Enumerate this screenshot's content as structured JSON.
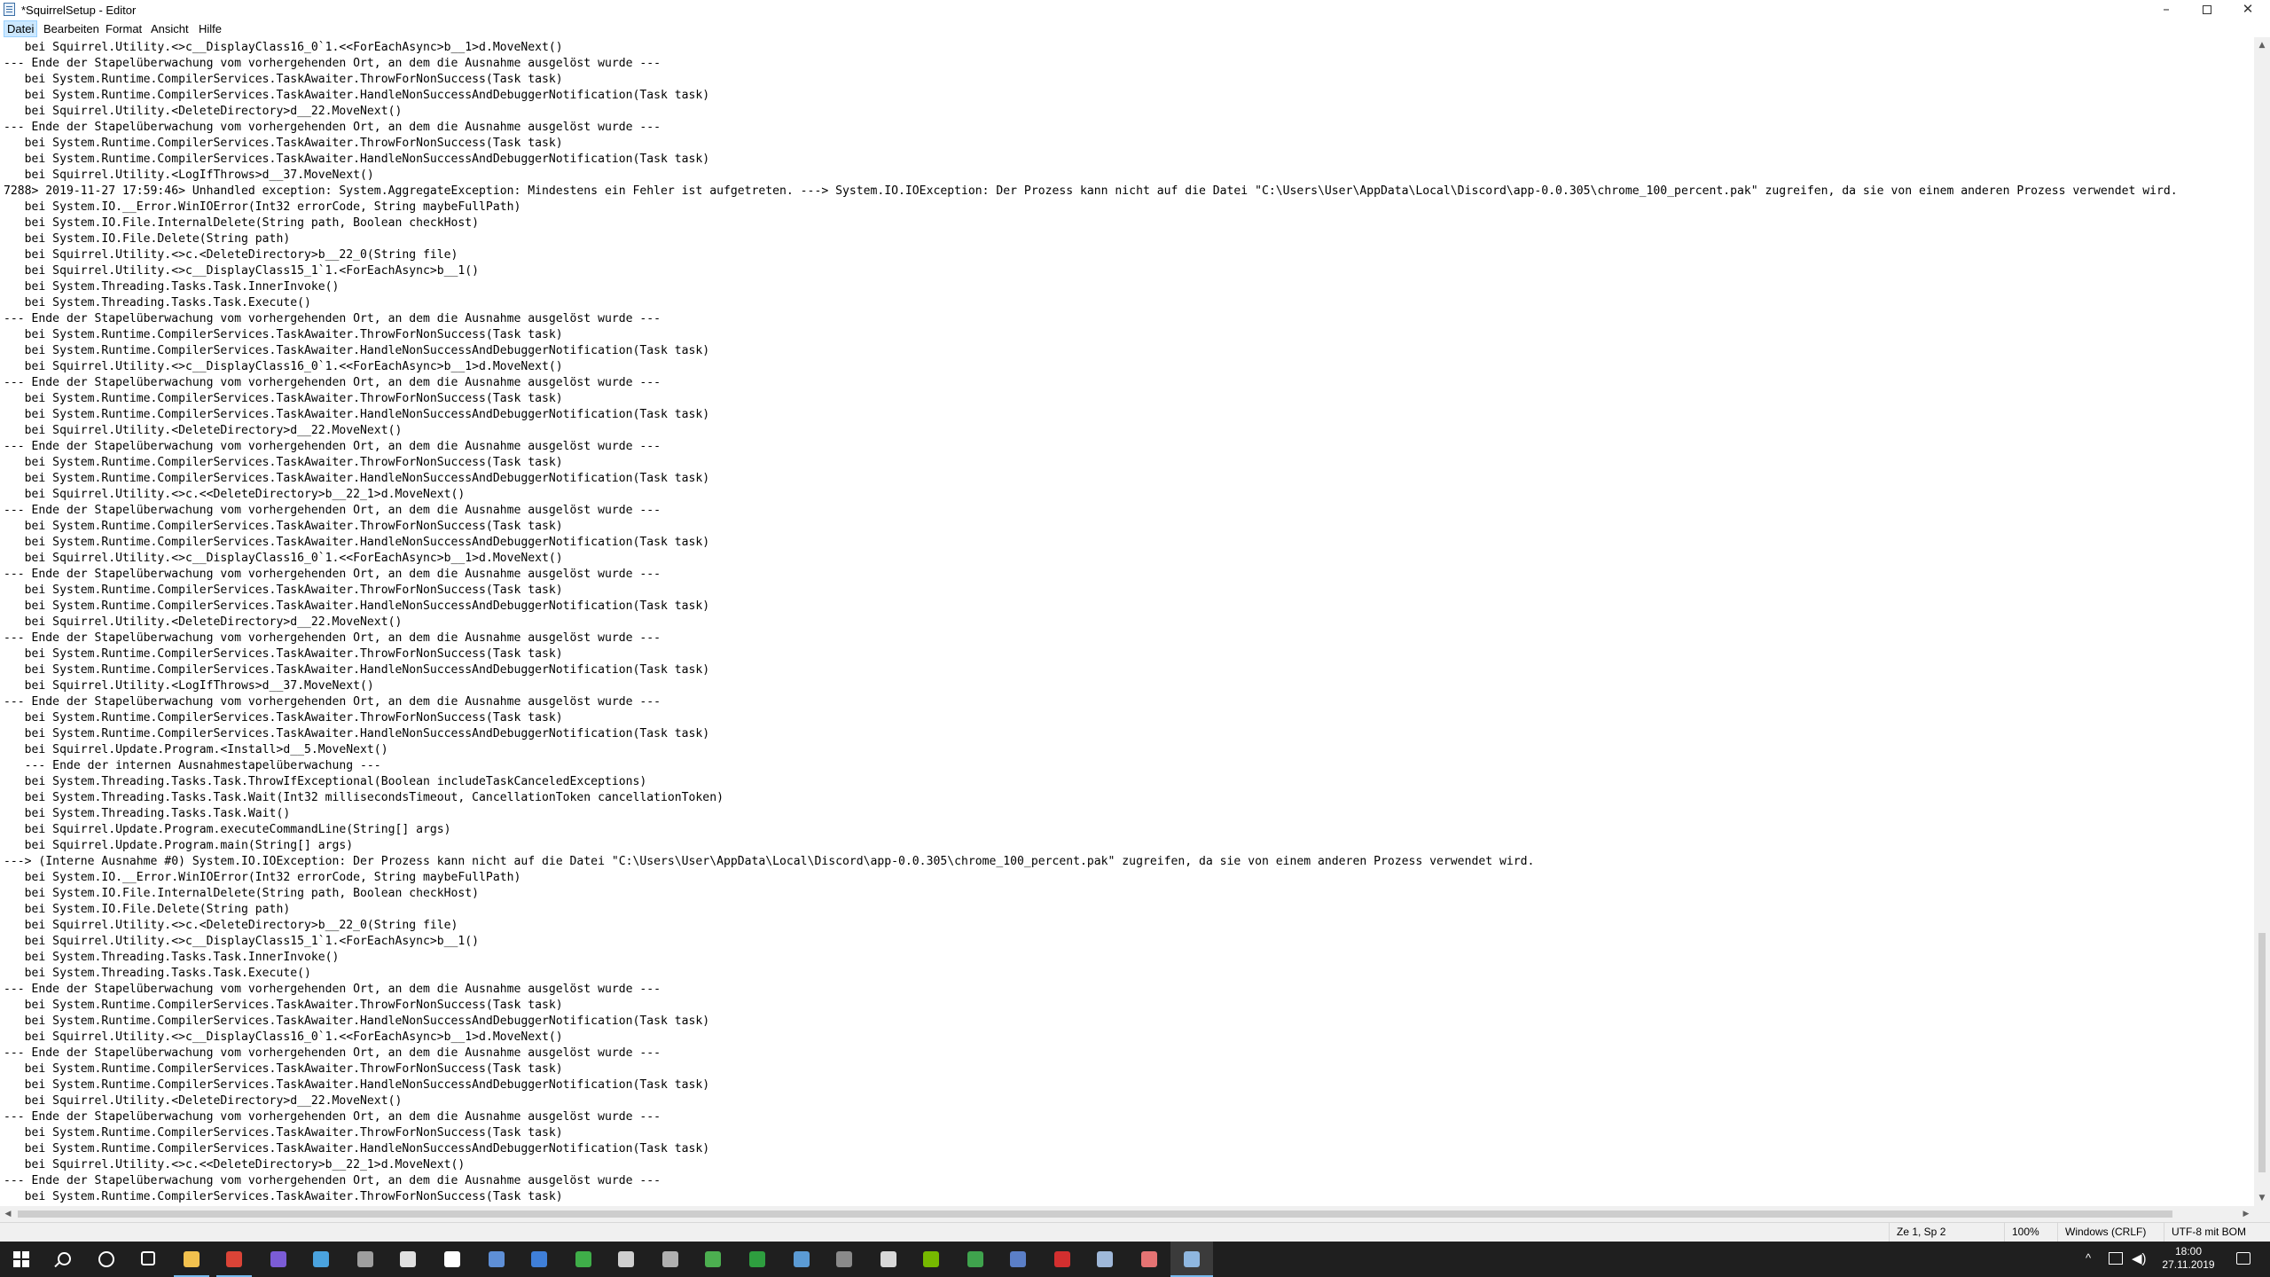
{
  "window": {
    "title": "*SquirrelSetup - Editor",
    "minimize": "–",
    "close": "✕"
  },
  "menu": {
    "datei": "Datei",
    "bearbeiten": "Bearbeiten",
    "format": "Format",
    "ansicht": "Ansicht",
    "hilfe": "Hilfe"
  },
  "editor": {
    "lines": [
      "   bei Squirrel.Utility.<>c__DisplayClass16_0`1.<<ForEachAsync>b__1>d.MoveNext()",
      "--- Ende der Stapelüberwachung vom vorhergehenden Ort, an dem die Ausnahme ausgelöst wurde ---",
      "   bei System.Runtime.CompilerServices.TaskAwaiter.ThrowForNonSuccess(Task task)",
      "   bei System.Runtime.CompilerServices.TaskAwaiter.HandleNonSuccessAndDebuggerNotification(Task task)",
      "   bei Squirrel.Utility.<DeleteDirectory>d__22.MoveNext()",
      "--- Ende der Stapelüberwachung vom vorhergehenden Ort, an dem die Ausnahme ausgelöst wurde ---",
      "   bei System.Runtime.CompilerServices.TaskAwaiter.ThrowForNonSuccess(Task task)",
      "   bei System.Runtime.CompilerServices.TaskAwaiter.HandleNonSuccessAndDebuggerNotification(Task task)",
      "   bei Squirrel.Utility.<LogIfThrows>d__37.MoveNext()",
      "7288> 2019-11-27 17:59:46> Unhandled exception: System.AggregateException: Mindestens ein Fehler ist aufgetreten. ---> System.IO.IOException: Der Prozess kann nicht auf die Datei \"C:\\Users\\User\\AppData\\Local\\Discord\\app-0.0.305\\chrome_100_percent.pak\" zugreifen, da sie von einem anderen Prozess verwendet wird.",
      "   bei System.IO.__Error.WinIOError(Int32 errorCode, String maybeFullPath)",
      "   bei System.IO.File.InternalDelete(String path, Boolean checkHost)",
      "   bei System.IO.File.Delete(String path)",
      "   bei Squirrel.Utility.<>c.<DeleteDirectory>b__22_0(String file)",
      "   bei Squirrel.Utility.<>c__DisplayClass15_1`1.<ForEachAsync>b__1()",
      "   bei System.Threading.Tasks.Task.InnerInvoke()",
      "   bei System.Threading.Tasks.Task.Execute()",
      "--- Ende der Stapelüberwachung vom vorhergehenden Ort, an dem die Ausnahme ausgelöst wurde ---",
      "   bei System.Runtime.CompilerServices.TaskAwaiter.ThrowForNonSuccess(Task task)",
      "   bei System.Runtime.CompilerServices.TaskAwaiter.HandleNonSuccessAndDebuggerNotification(Task task)",
      "   bei Squirrel.Utility.<>c__DisplayClass16_0`1.<<ForEachAsync>b__1>d.MoveNext()",
      "--- Ende der Stapelüberwachung vom vorhergehenden Ort, an dem die Ausnahme ausgelöst wurde ---",
      "   bei System.Runtime.CompilerServices.TaskAwaiter.ThrowForNonSuccess(Task task)",
      "   bei System.Runtime.CompilerServices.TaskAwaiter.HandleNonSuccessAndDebuggerNotification(Task task)",
      "   bei Squirrel.Utility.<DeleteDirectory>d__22.MoveNext()",
      "--- Ende der Stapelüberwachung vom vorhergehenden Ort, an dem die Ausnahme ausgelöst wurde ---",
      "   bei System.Runtime.CompilerServices.TaskAwaiter.ThrowForNonSuccess(Task task)",
      "   bei System.Runtime.CompilerServices.TaskAwaiter.HandleNonSuccessAndDebuggerNotification(Task task)",
      "   bei Squirrel.Utility.<>c.<<DeleteDirectory>b__22_1>d.MoveNext()",
      "--- Ende der Stapelüberwachung vom vorhergehenden Ort, an dem die Ausnahme ausgelöst wurde ---",
      "   bei System.Runtime.CompilerServices.TaskAwaiter.ThrowForNonSuccess(Task task)",
      "   bei System.Runtime.CompilerServices.TaskAwaiter.HandleNonSuccessAndDebuggerNotification(Task task)",
      "   bei Squirrel.Utility.<>c__DisplayClass16_0`1.<<ForEachAsync>b__1>d.MoveNext()",
      "--- Ende der Stapelüberwachung vom vorhergehenden Ort, an dem die Ausnahme ausgelöst wurde ---",
      "   bei System.Runtime.CompilerServices.TaskAwaiter.ThrowForNonSuccess(Task task)",
      "   bei System.Runtime.CompilerServices.TaskAwaiter.HandleNonSuccessAndDebuggerNotification(Task task)",
      "   bei Squirrel.Utility.<DeleteDirectory>d__22.MoveNext()",
      "--- Ende der Stapelüberwachung vom vorhergehenden Ort, an dem die Ausnahme ausgelöst wurde ---",
      "   bei System.Runtime.CompilerServices.TaskAwaiter.ThrowForNonSuccess(Task task)",
      "   bei System.Runtime.CompilerServices.TaskAwaiter.HandleNonSuccessAndDebuggerNotification(Task task)",
      "   bei Squirrel.Utility.<LogIfThrows>d__37.MoveNext()",
      "--- Ende der Stapelüberwachung vom vorhergehenden Ort, an dem die Ausnahme ausgelöst wurde ---",
      "   bei System.Runtime.CompilerServices.TaskAwaiter.ThrowForNonSuccess(Task task)",
      "   bei System.Runtime.CompilerServices.TaskAwaiter.HandleNonSuccessAndDebuggerNotification(Task task)",
      "   bei Squirrel.Update.Program.<Install>d__5.MoveNext()",
      "   --- Ende der internen Ausnahmestapelüberwachung ---",
      "   bei System.Threading.Tasks.Task.ThrowIfExceptional(Boolean includeTaskCanceledExceptions)",
      "   bei System.Threading.Tasks.Task.Wait(Int32 millisecondsTimeout, CancellationToken cancellationToken)",
      "   bei System.Threading.Tasks.Task.Wait()",
      "   bei Squirrel.Update.Program.executeCommandLine(String[] args)",
      "   bei Squirrel.Update.Program.main(String[] args)",
      "---> (Interne Ausnahme #0) System.IO.IOException: Der Prozess kann nicht auf die Datei \"C:\\Users\\User\\AppData\\Local\\Discord\\app-0.0.305\\chrome_100_percent.pak\" zugreifen, da sie von einem anderen Prozess verwendet wird.",
      "   bei System.IO.__Error.WinIOError(Int32 errorCode, String maybeFullPath)",
      "   bei System.IO.File.InternalDelete(String path, Boolean checkHost)",
      "   bei System.IO.File.Delete(String path)",
      "   bei Squirrel.Utility.<>c.<DeleteDirectory>b__22_0(String file)",
      "   bei Squirrel.Utility.<>c__DisplayClass15_1`1.<ForEachAsync>b__1()",
      "   bei System.Threading.Tasks.Task.InnerInvoke()",
      "   bei System.Threading.Tasks.Task.Execute()",
      "--- Ende der Stapelüberwachung vom vorhergehenden Ort, an dem die Ausnahme ausgelöst wurde ---",
      "   bei System.Runtime.CompilerServices.TaskAwaiter.ThrowForNonSuccess(Task task)",
      "   bei System.Runtime.CompilerServices.TaskAwaiter.HandleNonSuccessAndDebuggerNotification(Task task)",
      "   bei Squirrel.Utility.<>c__DisplayClass16_0`1.<<ForEachAsync>b__1>d.MoveNext()",
      "--- Ende der Stapelüberwachung vom vorhergehenden Ort, an dem die Ausnahme ausgelöst wurde ---",
      "   bei System.Runtime.CompilerServices.TaskAwaiter.ThrowForNonSuccess(Task task)",
      "   bei System.Runtime.CompilerServices.TaskAwaiter.HandleNonSuccessAndDebuggerNotification(Task task)",
      "   bei Squirrel.Utility.<DeleteDirectory>d__22.MoveNext()",
      "--- Ende der Stapelüberwachung vom vorhergehenden Ort, an dem die Ausnahme ausgelöst wurde ---",
      "   bei System.Runtime.CompilerServices.TaskAwaiter.ThrowForNonSuccess(Task task)",
      "   bei System.Runtime.CompilerServices.TaskAwaiter.HandleNonSuccessAndDebuggerNotification(Task task)",
      "   bei Squirrel.Utility.<>c.<<DeleteDirectory>b__22_1>d.MoveNext()",
      "--- Ende der Stapelüberwachung vom vorhergehenden Ort, an dem die Ausnahme ausgelöst wurde ---",
      "   bei System.Runtime.CompilerServices.TaskAwaiter.ThrowForNonSuccess(Task task)"
    ]
  },
  "statusbar": {
    "position": "Ze 1, Sp 2",
    "zoom": "100%",
    "line_ending": "Windows (CRLF)",
    "encoding": "UTF-8 mit BOM"
  },
  "taskbar": {
    "icons": [
      {
        "name": "start-icon",
        "color": "#ffffff"
      },
      {
        "name": "search-icon",
        "color": "#ffffff"
      },
      {
        "name": "cortana-icon",
        "color": "#ffffff"
      },
      {
        "name": "task-view-icon",
        "color": "#ffffff"
      },
      {
        "name": "file-explorer-icon",
        "color": "#f2c14e"
      },
      {
        "name": "chrome-icon",
        "color": "#db4437"
      },
      {
        "name": "app-purple-icon",
        "color": "#7b5cd6"
      },
      {
        "name": "app-multicolor-icon",
        "color": "#4aa3df"
      },
      {
        "name": "app-terminal-icon",
        "color": "#9e9e9e"
      },
      {
        "name": "calculator-icon",
        "color": "#e0e0e0"
      },
      {
        "name": "snipping-icon",
        "color": "#ffffff"
      },
      {
        "name": "app-circle-icon",
        "color": "#5e8fd6"
      },
      {
        "name": "app-grid-icon",
        "color": "#3f7fd8"
      },
      {
        "name": "app-green-icon",
        "color": "#3fae49"
      },
      {
        "name": "app-arrow-icon",
        "color": "#cfcfcf"
      },
      {
        "name": "app-storage-icon",
        "color": "#b0b0b0"
      },
      {
        "name": "app-notes-icon",
        "color": "#4caf50"
      },
      {
        "name": "xbox-icon",
        "color": "#2e9e3f"
      },
      {
        "name": "steam-icon",
        "color": "#5b9bd5"
      },
      {
        "name": "app-gauge-icon",
        "color": "#8a8a8a"
      },
      {
        "name": "app-box-icon",
        "color": "#d8d8d8"
      },
      {
        "name": "nvidia-icon",
        "color": "#76b900"
      },
      {
        "name": "app-leaf-icon",
        "color": "#3fa34d"
      },
      {
        "name": "app-sphere-icon",
        "color": "#5b7fc7"
      },
      {
        "name": "app-red-icon",
        "color": "#d32f2f"
      },
      {
        "name": "app-window-icon",
        "color": "#9fb8d9"
      },
      {
        "name": "app-cloud-icon",
        "color": "#e57373"
      },
      {
        "name": "notepad-icon",
        "color": "#8fb7e0"
      }
    ],
    "clock_time": "18:00",
    "clock_date": "27.11.2019"
  }
}
